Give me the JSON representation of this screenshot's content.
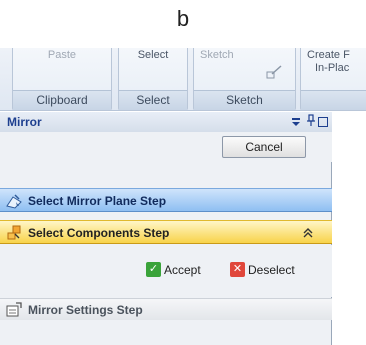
{
  "caption": "b",
  "ribbon": {
    "clipboard": {
      "top": "Paste",
      "label": "Clipboard"
    },
    "select": {
      "top": "Select",
      "label": "Select"
    },
    "sketch": {
      "top": "Sketch",
      "label": "Sketch"
    },
    "create": {
      "line1": "Create F",
      "line2": "In-Plac"
    }
  },
  "panel": {
    "title": "Mirror",
    "cancel_label": "Cancel",
    "steps": {
      "plane": "Select Mirror Plane Step",
      "components": "Select Components Step",
      "settings": "Mirror Settings Step"
    },
    "accept_label": "Accept",
    "deselect_label": "Deselect"
  },
  "colors": {
    "plane_step": "#8fbff2",
    "components_step": "#f8d34a",
    "accept_icon": "#3aa33a",
    "deselect_icon": "#e0473b",
    "title": "#1d3f8f"
  },
  "icons": [
    "dropdown-icon",
    "pin-icon",
    "close-icon",
    "plane-step-icon",
    "components-step-icon",
    "collapse-icon",
    "accept-icon",
    "deselect-icon",
    "settings-step-icon",
    "sketch-icon"
  ]
}
